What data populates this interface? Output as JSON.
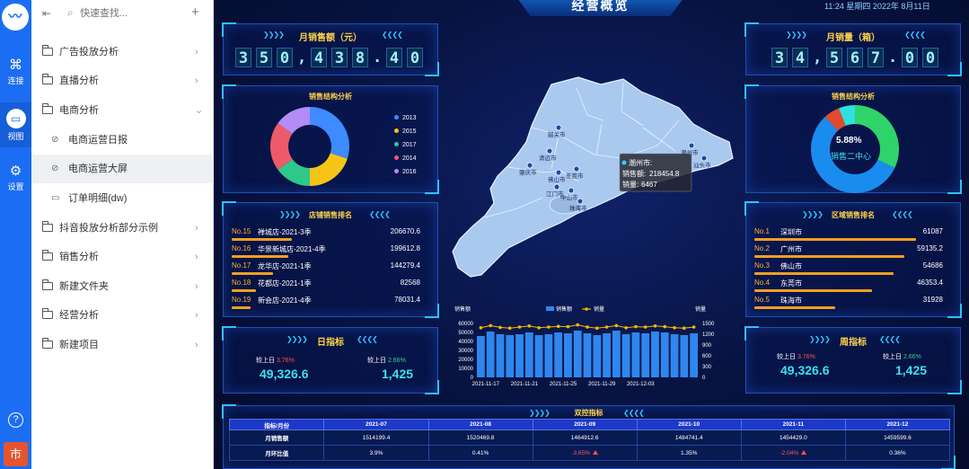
{
  "rail": {
    "items": [
      {
        "label": "连接",
        "icon": "command-icon"
      },
      {
        "label": "视图",
        "icon": "tv-icon"
      },
      {
        "label": "设置",
        "icon": "gear-icon"
      }
    ],
    "avatar": "市"
  },
  "sidebar": {
    "search_placeholder": "快速查找...",
    "items": [
      {
        "label": "广告投放分析",
        "type": "folder",
        "expanded": false
      },
      {
        "label": "直播分析",
        "type": "folder",
        "expanded": false
      },
      {
        "label": "电商分析",
        "type": "folder",
        "expanded": true
      },
      {
        "label": "电商运营日报",
        "type": "dashboard"
      },
      {
        "label": "电商运营大屏",
        "type": "dashboard",
        "active": true
      },
      {
        "label": "订单明细(dw)",
        "type": "table"
      },
      {
        "label": "抖音投放分析部分示例",
        "type": "folder",
        "expanded": false
      },
      {
        "label": "销售分析",
        "type": "folder",
        "expanded": false
      },
      {
        "label": "新建文件夹",
        "type": "folder",
        "expanded": false
      },
      {
        "label": "经营分析",
        "type": "folder",
        "expanded": false
      },
      {
        "label": "新建项目",
        "type": "folder",
        "expanded": false
      }
    ]
  },
  "dashboard": {
    "title": "经营概览",
    "clock": "11:24 星期四 2022年 8月11日",
    "monthly_sales": {
      "title": "月销售额（元）",
      "digits": [
        "3",
        "5",
        "0",
        ",",
        "4",
        "3",
        "8",
        ".",
        "4",
        "0"
      ]
    },
    "monthly_volume": {
      "title": "月销量（箱）",
      "digits": [
        "3",
        "4",
        ",",
        "5",
        "6",
        "7",
        ".",
        "0",
        "0"
      ]
    },
    "structure_left": {
      "title": "销售结构分析"
    },
    "structure_right": {
      "title": "销售结构分析",
      "center_pct": "5.88%",
      "center_name": "销售二中心"
    },
    "store_rank": {
      "title": "店铺销售排名",
      "rows": [
        {
          "no": "No.15",
          "name": "禅城店-2021-3季",
          "value": "206670.6",
          "pct": 0.32
        },
        {
          "no": "No.16",
          "name": "华景新城店-2021-4季",
          "value": "199612.8",
          "pct": 0.3
        },
        {
          "no": "No.17",
          "name": "龙华店-2021-1季",
          "value": "144279.4",
          "pct": 0.22
        },
        {
          "no": "No.18",
          "name": "花都店-2021-1季",
          "value": "82568",
          "pct": 0.13
        },
        {
          "no": "No.19",
          "name": "新会店-2021-4季",
          "value": "78031.4",
          "pct": 0.1
        }
      ]
    },
    "region_rank": {
      "title": "区域销售排名",
      "rows": [
        {
          "no": "No.1",
          "name": "深圳市",
          "value": "61087",
          "pct": 1.0
        },
        {
          "no": "No.2",
          "name": "广州市",
          "value": "59135.2",
          "pct": 0.93
        },
        {
          "no": "No.3",
          "name": "佛山市",
          "value": "54686",
          "pct": 0.86
        },
        {
          "no": "No.4",
          "name": "东莞市",
          "value": "46353.4",
          "pct": 0.73
        },
        {
          "no": "No.5",
          "name": "珠海市",
          "value": "31928",
          "pct": 0.5
        }
      ]
    },
    "daily": {
      "title": "日指标",
      "l1": "较上日",
      "c1": "3.76%",
      "v1": "49,326.6",
      "l2": "较上日",
      "c2": "2.66%",
      "v2": "1,425"
    },
    "weekly": {
      "title": "周指标",
      "l1": "较上日",
      "c1": "3.76%",
      "v1": "49,326.6",
      "l2": "较上日",
      "c2": "2.66%",
      "v2": "1,425"
    },
    "map": {
      "cities": [
        "韶关市",
        "潮州市",
        "清远市",
        "汕头市",
        "肇庆市",
        "佛山市",
        "东莞市",
        "江门市",
        "中山市",
        "珠海市"
      ],
      "tooltip": {
        "city": "潮州市:",
        "sales_label": "销售额:",
        "sales": "218454.8",
        "vol_label": "销量:",
        "vol": "6467"
      }
    },
    "table": {
      "title": "双控指标",
      "header": [
        "指标/月份",
        "2021-07",
        "2021-08",
        "2021-09",
        "2021-10",
        "2021-11",
        "2021-12"
      ],
      "rows": [
        [
          "月销售额",
          "1514199.4",
          "1520469.8",
          "1464912.6",
          "1484741.4",
          "1454429.0",
          "1459599.6"
        ],
        [
          "月环比值",
          "3.9%",
          "0.41%",
          "-3.65%",
          "1.35%",
          "-2.04%",
          "0.36%"
        ]
      ]
    }
  },
  "chart_data": [
    {
      "type": "pie",
      "title": "销售结构分析",
      "categories": [
        "2013",
        "2015",
        "2017",
        "2014",
        "2016"
      ],
      "values": [
        30,
        20,
        15,
        20,
        15
      ],
      "colors": [
        "#3d8bff",
        "#f5c518",
        "#2ec98a",
        "#ef5a6a",
        "#b38cf5"
      ],
      "legend": "right"
    },
    {
      "type": "pie",
      "title": "销售结构分析",
      "categories": [
        "",
        "",
        "",
        ""
      ],
      "values": [
        32,
        56.12,
        5.88,
        6
      ],
      "colors": [
        "#2ed36a",
        "#1a8cf0",
        "#e24a2e",
        "#2ee0e0"
      ]
    },
    {
      "type": "bar",
      "xlabel": "",
      "ylabel": "销售额",
      "y2label": "销量",
      "legend": "top",
      "ylim": [
        0,
        60000
      ],
      "y2lim": [
        0,
        1500
      ],
      "yticks": [
        0,
        10000,
        20000,
        30000,
        40000,
        50000,
        60000
      ],
      "y2ticks": [
        0,
        300,
        600,
        900,
        1200,
        1500
      ],
      "x_ticks": [
        "2021-11-17",
        "2021-11-21",
        "2021-11-25",
        "2021-11-29",
        "2021-12-03"
      ],
      "series": [
        {
          "name": "销售额",
          "type": "bar",
          "values": [
            46000,
            51000,
            48000,
            47000,
            48000,
            50000,
            47000,
            48000,
            50000,
            49000,
            52000,
            49000,
            47000,
            49000,
            52000,
            48000,
            50000,
            49000,
            51000,
            50000,
            48000,
            47000,
            49000
          ]
        },
        {
          "name": "销量",
          "type": "line",
          "values": [
            1380,
            1440,
            1390,
            1370,
            1400,
            1430,
            1380,
            1400,
            1420,
            1410,
            1460,
            1400,
            1370,
            1400,
            1440,
            1380,
            1410,
            1400,
            1430,
            1410,
            1380,
            1370,
            1400
          ]
        }
      ]
    }
  ]
}
